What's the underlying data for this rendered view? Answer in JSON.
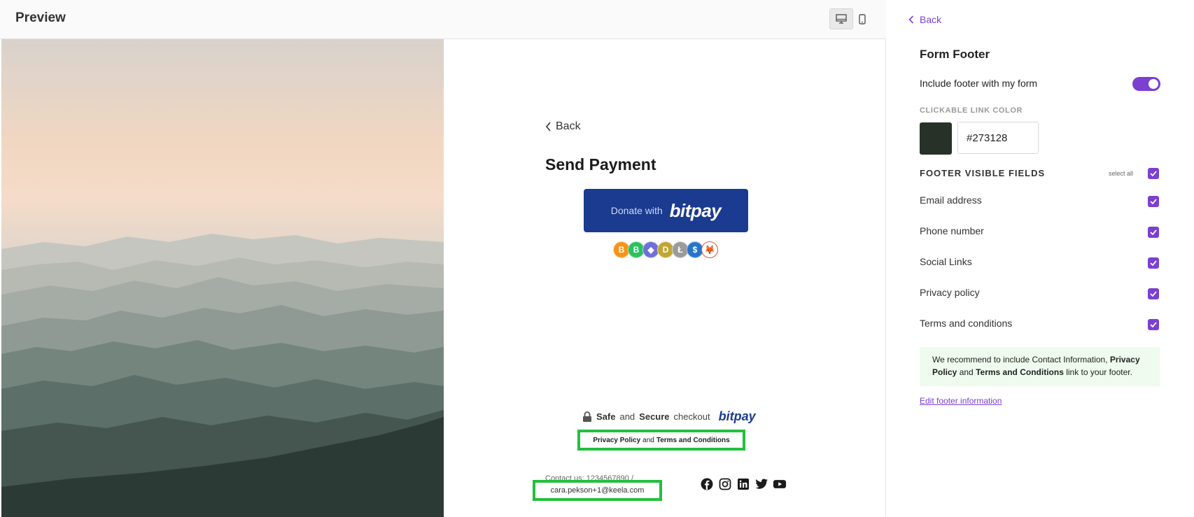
{
  "preview": {
    "title": "Preview",
    "device_buttons": [
      "desktop-icon",
      "mobile-icon"
    ]
  },
  "form": {
    "back_label": "Back",
    "title": "Send Payment",
    "bitpay_button": {
      "prefix": "Donate with",
      "brand": "bitpay"
    },
    "coins": [
      {
        "name": "bitcoin-coin-icon",
        "color": "#f7931a",
        "glyph": "B"
      },
      {
        "name": "bitcoin-cash-coin-icon",
        "color": "#2cc15e",
        "glyph": "B"
      },
      {
        "name": "ethereum-coin-icon",
        "color": "#6f6fd8",
        "glyph": "◆"
      },
      {
        "name": "dogecoin-coin-icon",
        "color": "#c2a633",
        "glyph": "D"
      },
      {
        "name": "litecoin-coin-icon",
        "color": "#9b9b9b",
        "glyph": "Ł"
      },
      {
        "name": "usdc-coin-icon",
        "color": "#2775ca",
        "glyph": "$"
      },
      {
        "name": "shiba-coin-icon",
        "color": "#ffffff",
        "glyph": "🦊"
      }
    ],
    "secure": {
      "safe": "Safe",
      "and": "and",
      "secure": "Secure",
      "checkout": "checkout",
      "brand": "bitpay"
    },
    "policy": {
      "privacy": "Privacy Policy",
      "and": "and",
      "terms": "Terms and Conditions"
    },
    "contact_text": "Contact us: 1234567890 /",
    "email": "cara.pekson+1@keela.com",
    "socials": [
      "facebook-icon",
      "instagram-icon",
      "linkedin-icon",
      "twitter-icon",
      "youtube-icon"
    ]
  },
  "panel": {
    "back_label": "Back",
    "title": "Form Footer",
    "include_label": "Include footer with my form",
    "include_enabled": true,
    "link_color_label": "CLICKABLE LINK COLOR",
    "link_color": "#273128",
    "fields_label": "FOOTER VISIBLE FIELDS",
    "select_all_label": "select all",
    "fields": [
      {
        "label": "Email address",
        "checked": true
      },
      {
        "label": "Phone number",
        "checked": true
      },
      {
        "label": "Social Links",
        "checked": true
      },
      {
        "label": "Privacy policy",
        "checked": true
      },
      {
        "label": "Terms and conditions",
        "checked": true
      }
    ],
    "notice": {
      "part1": "We recommend to include Contact Information,",
      "bold1": "Privacy Policy",
      "part2": "and",
      "bold2": "Terms and Conditions",
      "part3": "link to your footer."
    },
    "edit_link": "Edit footer information"
  },
  "colors": {
    "accent": "#7b3fd1",
    "bitpay_blue": "#1a3b8f",
    "highlight_green": "#22c03c"
  }
}
